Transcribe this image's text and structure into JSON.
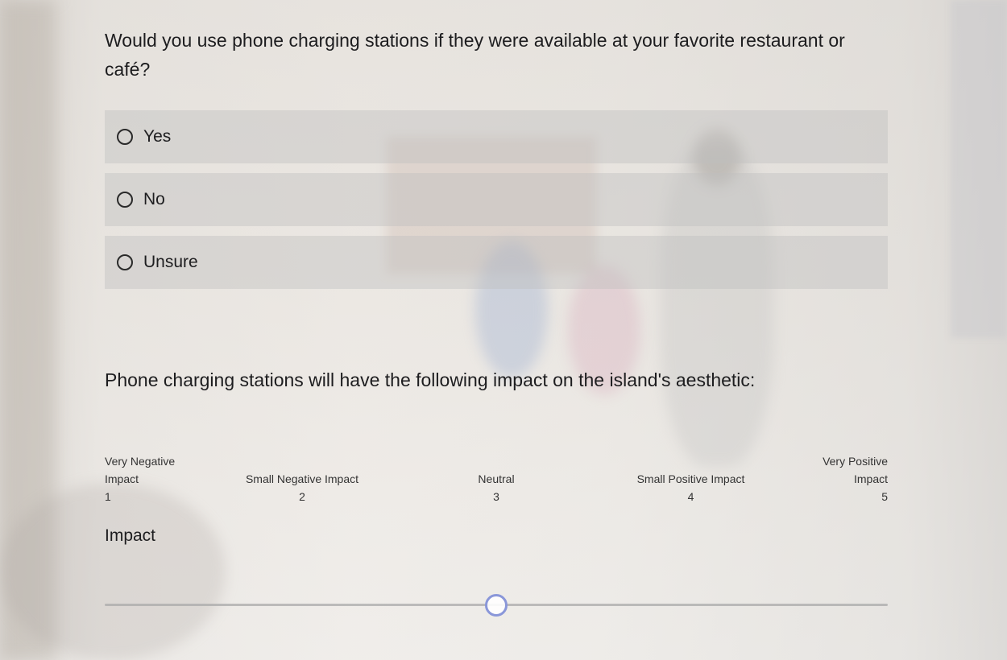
{
  "question1": {
    "title": "Would you use phone charging stations if they were available at your favorite restaurant or café?",
    "options": [
      {
        "label": "Yes",
        "selected": false
      },
      {
        "label": "No",
        "selected": false
      },
      {
        "label": "Unsure",
        "selected": false
      }
    ]
  },
  "question2": {
    "title": "Phone charging stations will have the following impact on the island's aesthetic:",
    "scale": [
      {
        "line1": "Very Negative",
        "line2": "Impact",
        "value": "1"
      },
      {
        "line1": "",
        "line2": "Small Negative Impact",
        "value": "2"
      },
      {
        "line1": "",
        "line2": "Neutral",
        "value": "3"
      },
      {
        "line1": "",
        "line2": "Small Positive Impact",
        "value": "4"
      },
      {
        "line1": "Very Positive",
        "line2": "Impact",
        "value": "5"
      }
    ],
    "slider": {
      "label": "Impact",
      "min": 1,
      "max": 5,
      "value": 3,
      "accent_color": "#8a97d9"
    }
  }
}
